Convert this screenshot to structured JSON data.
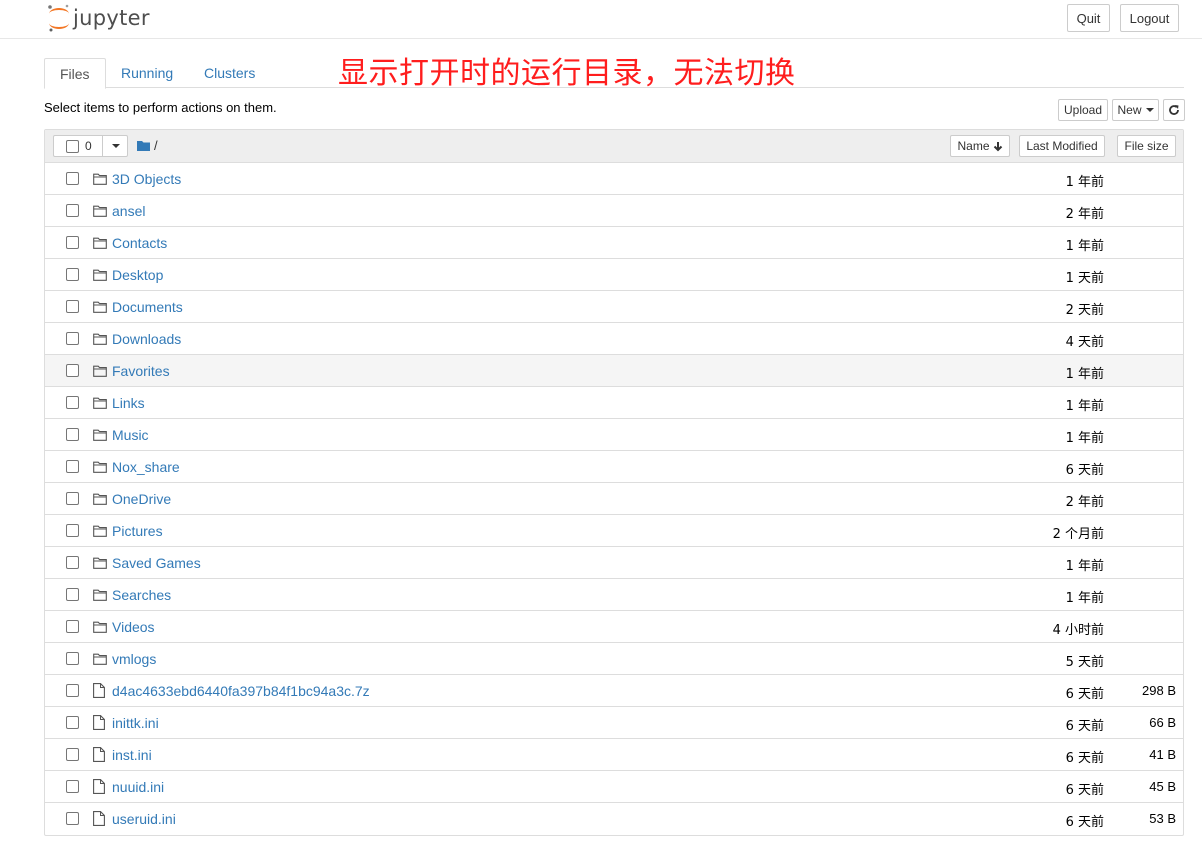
{
  "header": {
    "logo_text": "jupyter",
    "quit_label": "Quit",
    "logout_label": "Logout"
  },
  "tabs": [
    {
      "label": "Files",
      "active": true
    },
    {
      "label": "Running",
      "active": false
    },
    {
      "label": "Clusters",
      "active": false
    }
  ],
  "annotation": "显示打开时的运行目录，无法切换",
  "toolbar": {
    "hint": "Select items to perform actions on them.",
    "upload_label": "Upload",
    "new_label": "New",
    "refresh_icon": "refresh-icon"
  },
  "list_header": {
    "selected_count": "0",
    "breadcrumb": "/",
    "sort_name_label": "Name",
    "sort_modified_label": "Last Modified",
    "sort_size_label": "File size"
  },
  "colors": {
    "link": "#337ab7",
    "annotation": "#ff1d1d",
    "logo_orange": "#f37726"
  },
  "items": [
    {
      "type": "folder",
      "name": "3D Objects",
      "modified": "1 年前",
      "size": ""
    },
    {
      "type": "folder",
      "name": "ansel",
      "modified": "2 年前",
      "size": ""
    },
    {
      "type": "folder",
      "name": "Contacts",
      "modified": "1 年前",
      "size": ""
    },
    {
      "type": "folder",
      "name": "Desktop",
      "modified": "1 天前",
      "size": ""
    },
    {
      "type": "folder",
      "name": "Documents",
      "modified": "2 天前",
      "size": ""
    },
    {
      "type": "folder",
      "name": "Downloads",
      "modified": "4 天前",
      "size": ""
    },
    {
      "type": "folder",
      "name": "Favorites",
      "modified": "1 年前",
      "size": "",
      "hover": true
    },
    {
      "type": "folder",
      "name": "Links",
      "modified": "1 年前",
      "size": ""
    },
    {
      "type": "folder",
      "name": "Music",
      "modified": "1 年前",
      "size": ""
    },
    {
      "type": "folder",
      "name": "Nox_share",
      "modified": "6 天前",
      "size": ""
    },
    {
      "type": "folder",
      "name": "OneDrive",
      "modified": "2 年前",
      "size": ""
    },
    {
      "type": "folder",
      "name": "Pictures",
      "modified": "2 个月前",
      "size": ""
    },
    {
      "type": "folder",
      "name": "Saved Games",
      "modified": "1 年前",
      "size": ""
    },
    {
      "type": "folder",
      "name": "Searches",
      "modified": "1 年前",
      "size": ""
    },
    {
      "type": "folder",
      "name": "Videos",
      "modified": "4 小时前",
      "size": ""
    },
    {
      "type": "folder",
      "name": "vmlogs",
      "modified": "5 天前",
      "size": ""
    },
    {
      "type": "file",
      "name": "d4ac4633ebd6440fa397b84f1bc94a3c.7z",
      "modified": "6 天前",
      "size": "298 B"
    },
    {
      "type": "file",
      "name": "inittk.ini",
      "modified": "6 天前",
      "size": "66 B"
    },
    {
      "type": "file",
      "name": "inst.ini",
      "modified": "6 天前",
      "size": "41 B"
    },
    {
      "type": "file",
      "name": "nuuid.ini",
      "modified": "6 天前",
      "size": "45 B"
    },
    {
      "type": "file",
      "name": "useruid.ini",
      "modified": "6 天前",
      "size": "53 B"
    }
  ]
}
